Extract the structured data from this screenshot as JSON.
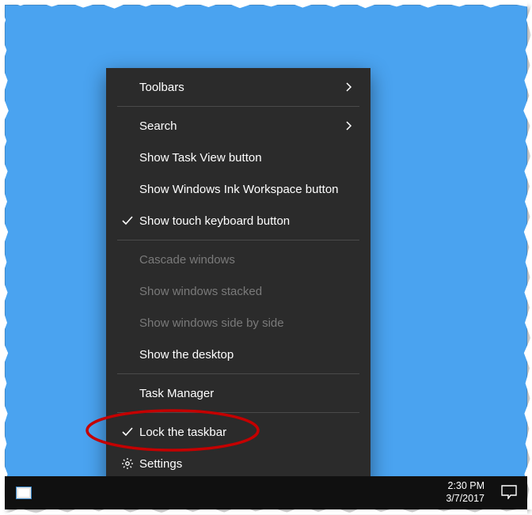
{
  "menu": {
    "items": [
      {
        "label": "Toolbars",
        "submenu": true,
        "checked": false,
        "disabled": false,
        "icon": null
      },
      {
        "sep": true
      },
      {
        "label": "Search",
        "submenu": true,
        "checked": false,
        "disabled": false,
        "icon": null
      },
      {
        "label": "Show Task View button",
        "submenu": false,
        "checked": false,
        "disabled": false,
        "icon": null
      },
      {
        "label": "Show Windows Ink Workspace button",
        "submenu": false,
        "checked": false,
        "disabled": false,
        "icon": null
      },
      {
        "label": "Show touch keyboard button",
        "submenu": false,
        "checked": true,
        "disabled": false,
        "icon": null
      },
      {
        "sep": true
      },
      {
        "label": "Cascade windows",
        "submenu": false,
        "checked": false,
        "disabled": true,
        "icon": null
      },
      {
        "label": "Show windows stacked",
        "submenu": false,
        "checked": false,
        "disabled": true,
        "icon": null
      },
      {
        "label": "Show windows side by side",
        "submenu": false,
        "checked": false,
        "disabled": true,
        "icon": null
      },
      {
        "label": "Show the desktop",
        "submenu": false,
        "checked": false,
        "disabled": false,
        "icon": null
      },
      {
        "sep": true
      },
      {
        "label": "Task Manager",
        "submenu": false,
        "checked": false,
        "disabled": false,
        "icon": null
      },
      {
        "sep": true
      },
      {
        "label": "Lock the taskbar",
        "submenu": false,
        "checked": true,
        "disabled": false,
        "icon": null,
        "highlighted": true
      },
      {
        "label": "Settings",
        "submenu": false,
        "checked": false,
        "disabled": false,
        "icon": "gear"
      }
    ]
  },
  "taskbar": {
    "time": "2:30 PM",
    "date": "3/7/2017"
  },
  "annotation": {
    "ellipse_color": "#c40000"
  }
}
